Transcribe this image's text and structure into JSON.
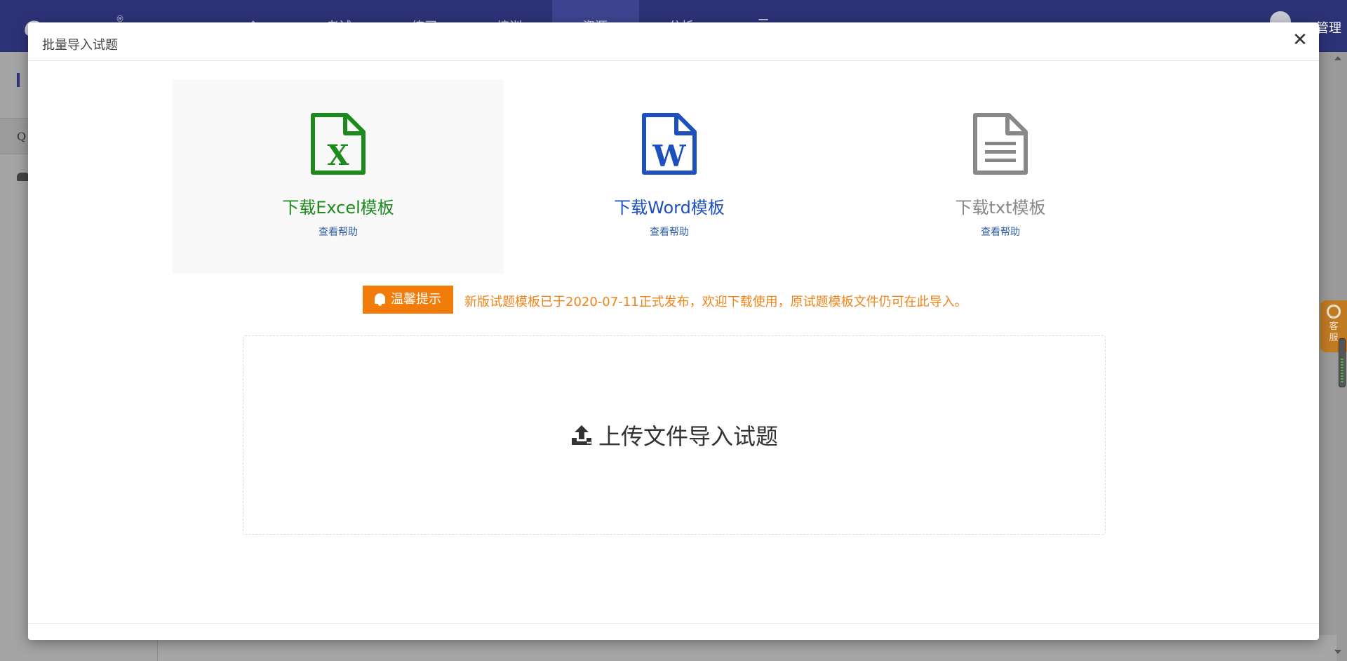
{
  "app": {
    "logo_mark": "e",
    "logo_reg": "®",
    "nav_items": [
      "考试",
      "练习",
      "培训",
      "资源",
      "分析"
    ],
    "admin_label": "管理"
  },
  "sidebar": {
    "row_label": "Q"
  },
  "modal": {
    "title": "批量导入试题",
    "close_glyph": "✕",
    "templates": [
      {
        "label": "下载Excel模板",
        "help": "查看帮助",
        "color": "#1d8a1d",
        "icon": "excel-file-icon",
        "letter": "X"
      },
      {
        "label": "下载Word模板",
        "help": "查看帮助",
        "color": "#1d4fbf",
        "icon": "word-file-icon",
        "letter": "W"
      },
      {
        "label": "下载txt模板",
        "help": "查看帮助",
        "color": "#888888",
        "icon": "txt-file-icon"
      }
    ],
    "tip": {
      "badge": "温馨提示",
      "text": "新版试题模板已于2020-07-11正式发布，欢迎下载使用，原试题模板文件仍可在此导入。"
    },
    "upload": {
      "label": "上传文件导入试题",
      "icon": "upload-icon"
    }
  },
  "widgets": {
    "kefu_label": "客服"
  },
  "colors": {
    "nav_bg": "#2d3277",
    "tip_orange": "#f27c0a",
    "help_link": "#2f5ea7"
  }
}
